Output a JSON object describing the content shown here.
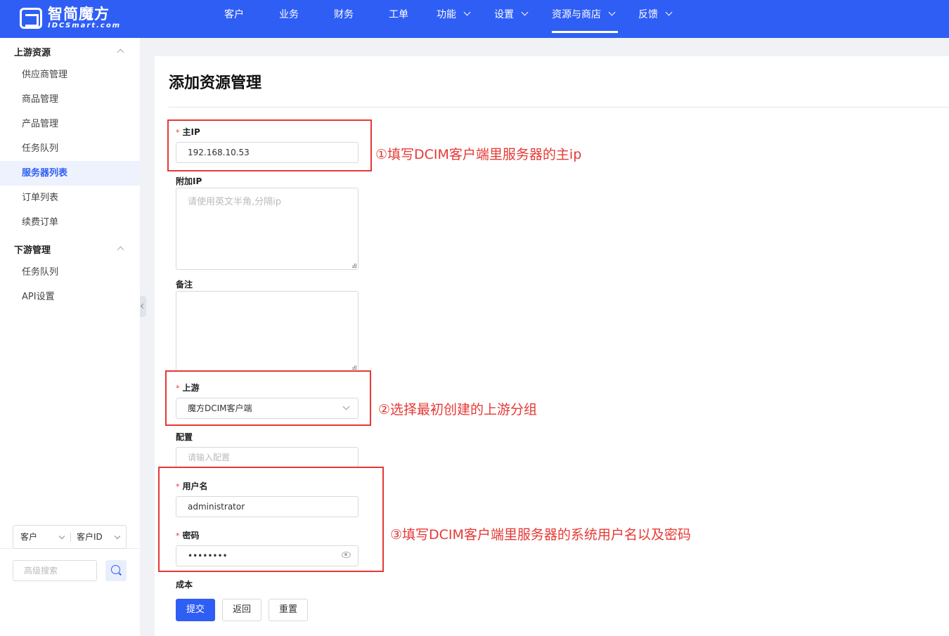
{
  "brand": {
    "name_cn": "智简魔方",
    "name_en": "IDCSmart.com"
  },
  "nav": [
    {
      "label": "客户",
      "dropdown": false
    },
    {
      "label": "业务",
      "dropdown": false
    },
    {
      "label": "财务",
      "dropdown": false
    },
    {
      "label": "工单",
      "dropdown": false
    },
    {
      "label": "功能",
      "dropdown": true
    },
    {
      "label": "设置",
      "dropdown": true
    },
    {
      "label": "资源与商店",
      "dropdown": true,
      "active": true
    },
    {
      "label": "反馈",
      "dropdown": true
    }
  ],
  "sidebar": {
    "groups": [
      {
        "label": "上游资源",
        "items": [
          "供应商管理",
          "商品管理",
          "产品管理",
          "任务队列",
          "服务器列表",
          "订单列表",
          "续费订单"
        ]
      },
      {
        "label": "下游管理",
        "items": [
          "任务队列",
          "API设置"
        ]
      }
    ],
    "active_item": "服务器列表",
    "search_type": "客户",
    "search_field": "客户ID",
    "search_placeholder": "高级搜索"
  },
  "page": {
    "title": "添加资源管理"
  },
  "form": {
    "main_ip": {
      "label": "主IP",
      "value": "192.168.10.53",
      "required": true
    },
    "extra_ip": {
      "label": "附加IP",
      "placeholder": "请使用英文半角,分隔ip"
    },
    "remark": {
      "label": "备注",
      "placeholder": ""
    },
    "upstream": {
      "label": "上游",
      "value": "魔方DCIM客户端",
      "required": true
    },
    "config": {
      "label": "配置",
      "placeholder": "请输入配置"
    },
    "username": {
      "label": "用户名",
      "value": "administrator",
      "required": true
    },
    "password": {
      "label": "密码",
      "value": "••••••••",
      "required": true
    },
    "cost": {
      "label": "成本"
    }
  },
  "buttons": {
    "submit": "提交",
    "back": "返回",
    "reset": "重置"
  },
  "annotations": [
    "①填写DCIM客户端里服务器的主ip",
    "②选择最初创建的上游分组",
    "③填写DCIM客户端里服务器的系统用户名以及密码"
  ],
  "colors": {
    "primary": "#2f5ef5",
    "annotation": "#e53935"
  }
}
